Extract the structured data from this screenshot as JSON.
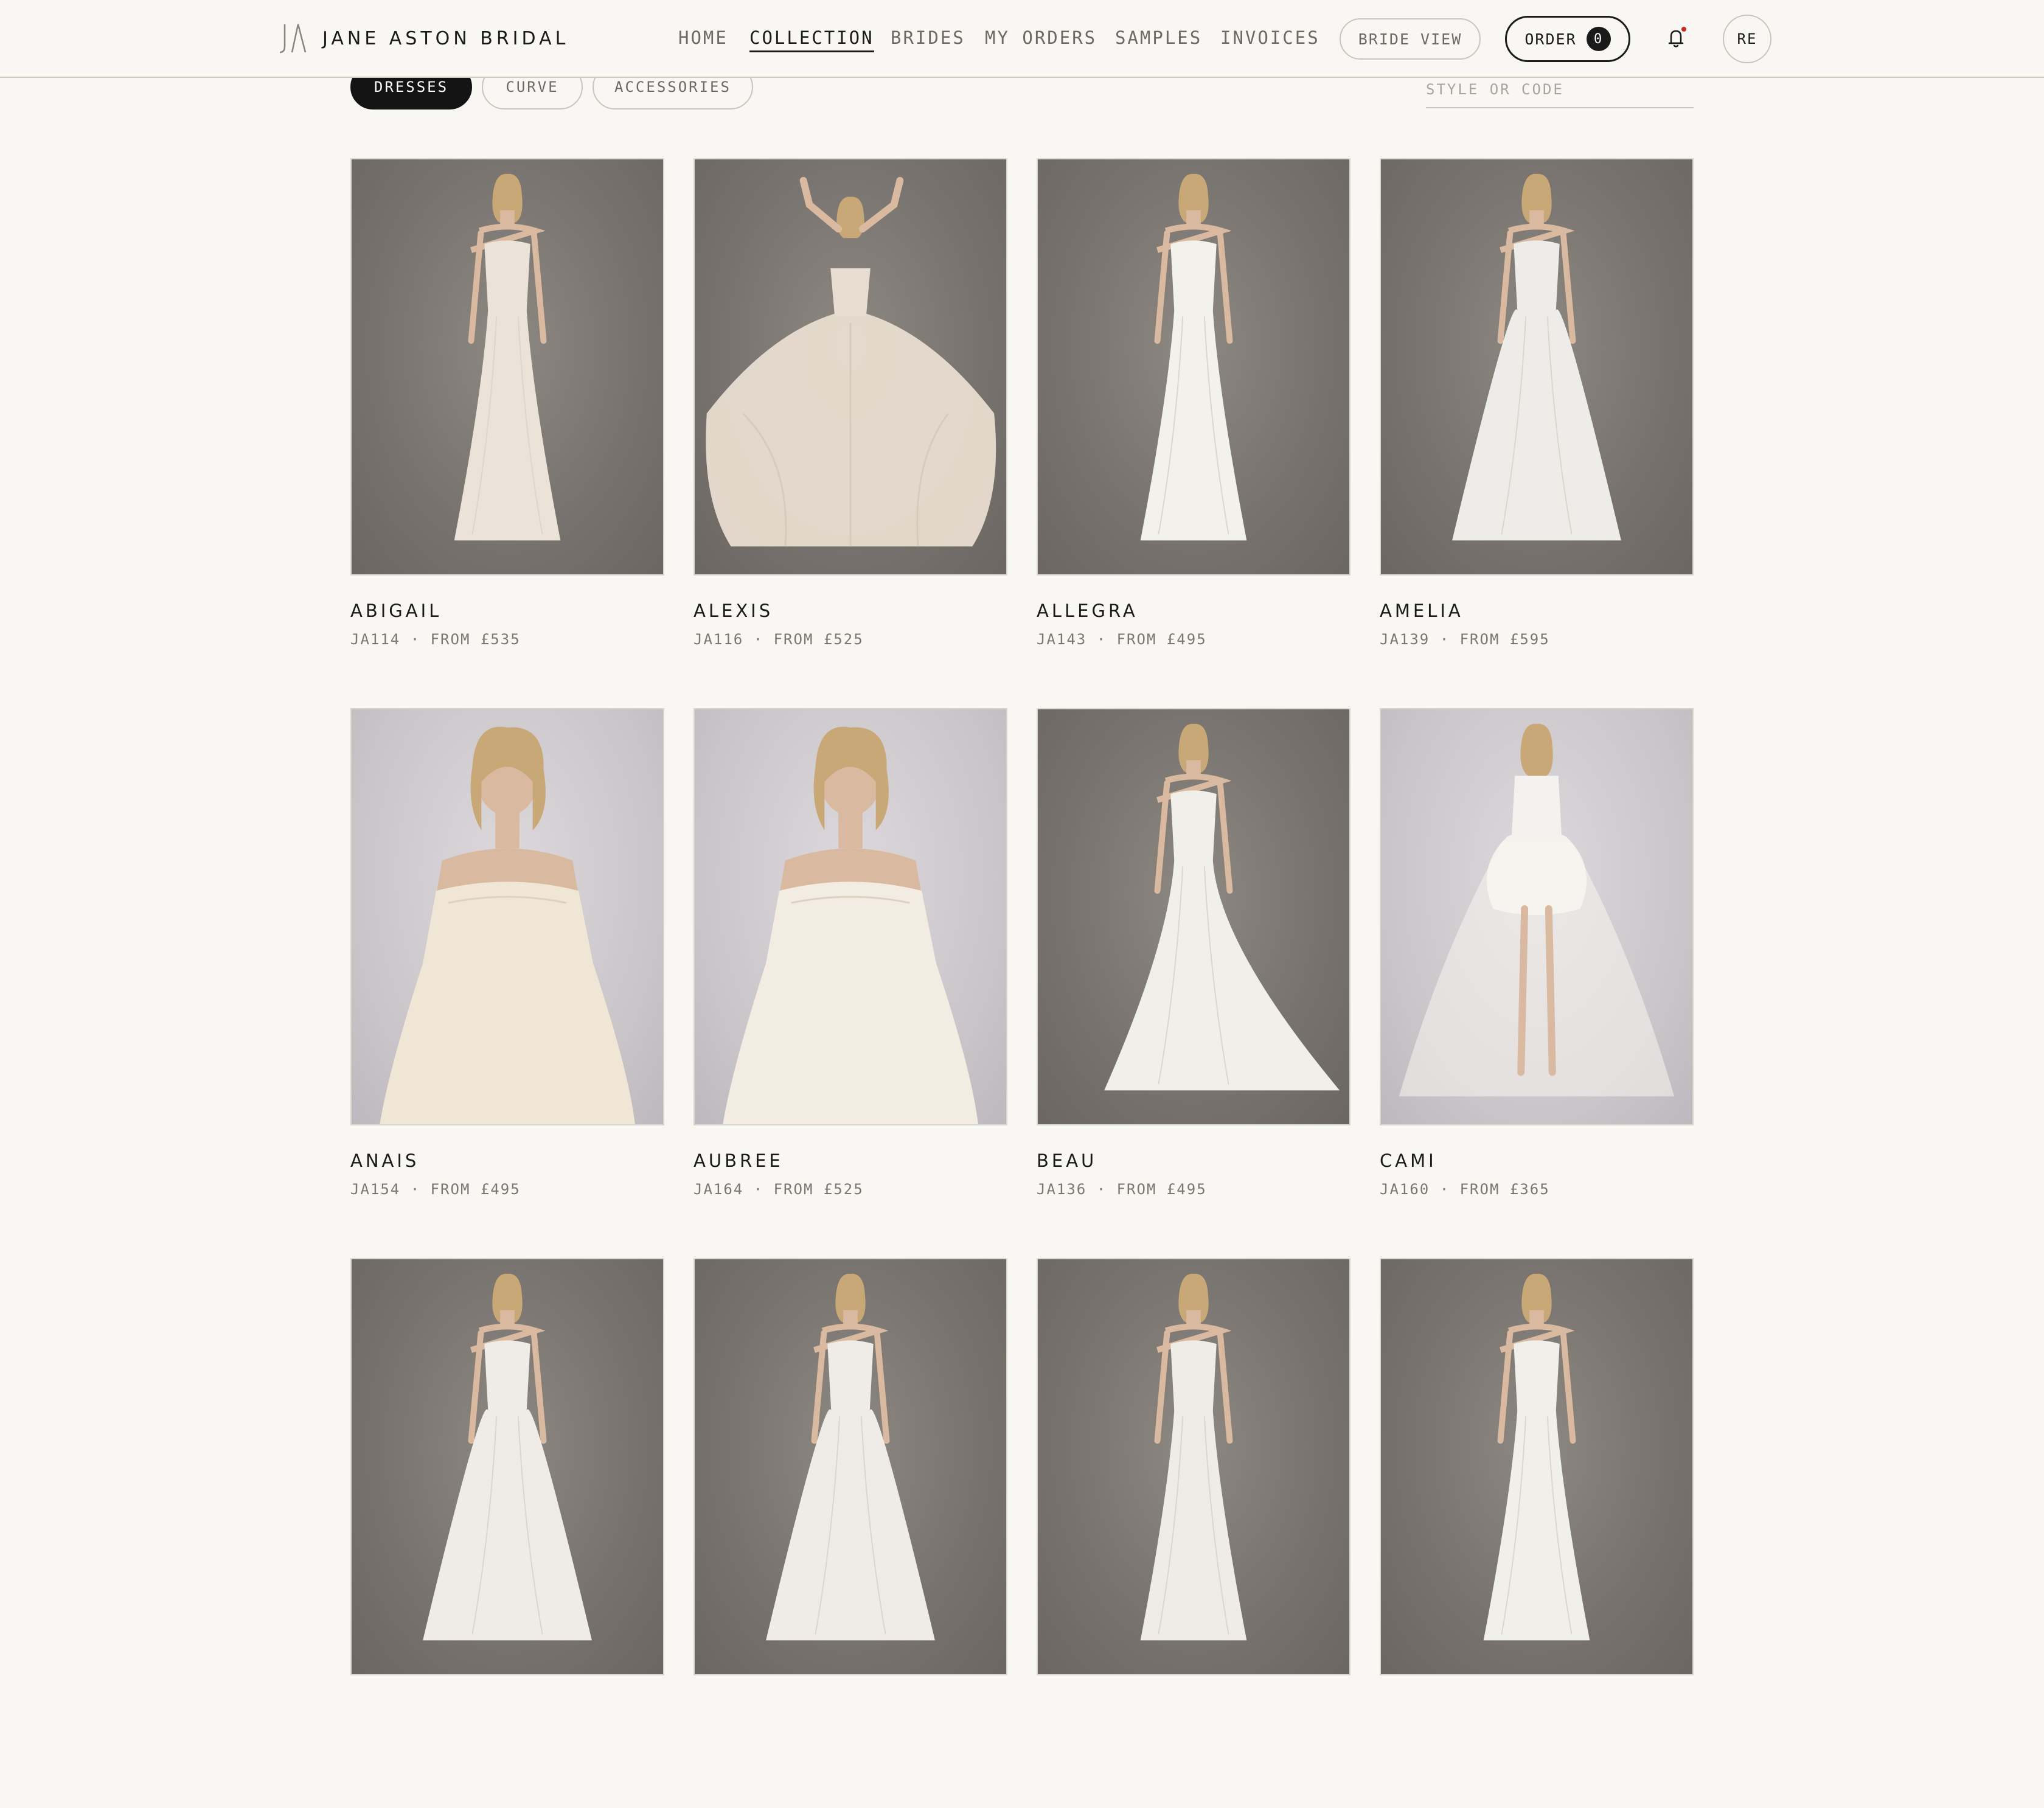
{
  "brand": {
    "name": "JANE ASTON BRIDAL",
    "logo_glyph": "JA"
  },
  "nav": [
    {
      "label": "HOME",
      "active": false
    },
    {
      "label": "COLLECTION",
      "active": true
    },
    {
      "label": "BRIDES",
      "active": false
    },
    {
      "label": "MY ORDERS",
      "active": false
    },
    {
      "label": "SAMPLES",
      "active": false
    },
    {
      "label": "INVOICES",
      "active": false
    }
  ],
  "header_actions": {
    "bride_view_label": "BRIDE VIEW",
    "order_label": "ORDER",
    "order_count": "0",
    "avatar_initials": "RE",
    "notification_dot_color": "#c62a2a"
  },
  "filters": {
    "tabs": [
      {
        "label": "DRESSES",
        "active": true
      },
      {
        "label": "CURVE",
        "active": false
      },
      {
        "label": "ACCESSORIES",
        "active": false
      }
    ],
    "search_placeholder": "STYLE OR CODE"
  },
  "colors": {
    "accent": "#141414",
    "background": "#f8f7f3",
    "muted_text": "#7a776f"
  },
  "products": [
    {
      "name": "ABIGAIL",
      "meta": "JA114 · FROM £535",
      "backdrop": "dark",
      "gown": "mermaid",
      "tone": "#ece3d8"
    },
    {
      "name": "ALEXIS",
      "meta": "JA116 · FROM £525",
      "backdrop": "dark",
      "gown": "ballgown",
      "tone": "#e8ddd0"
    },
    {
      "name": "ALLEGRA",
      "meta": "JA143 · FROM £495",
      "backdrop": "dark",
      "gown": "fit",
      "tone": "#f3f1ec"
    },
    {
      "name": "AMELIA",
      "meta": "JA139 · FROM £595",
      "backdrop": "dark",
      "gown": "aline",
      "tone": "#eeece8"
    },
    {
      "name": "ANAIS",
      "meta": "JA154 · FROM £495",
      "backdrop": "light",
      "gown": "closeup",
      "tone": "#efe6d6"
    },
    {
      "name": "AUBREE",
      "meta": "JA164 · FROM £525",
      "backdrop": "light",
      "gown": "closeup",
      "tone": "#f2ece3"
    },
    {
      "name": "BEAU",
      "meta": "JA136 · FROM £495",
      "backdrop": "dark",
      "gown": "train",
      "tone": "#f1efea"
    },
    {
      "name": "CAMI",
      "meta": "JA160 · FROM £365",
      "backdrop": "light",
      "gown": "short",
      "tone": "#f4f2ee"
    },
    {
      "name": "",
      "meta": "",
      "backdrop": "dark",
      "gown": "aline",
      "tone": "#efece7"
    },
    {
      "name": "",
      "meta": "",
      "backdrop": "dark",
      "gown": "aline",
      "tone": "#efece7"
    },
    {
      "name": "",
      "meta": "",
      "backdrop": "dark",
      "gown": "fit",
      "tone": "#efece7"
    },
    {
      "name": "",
      "meta": "",
      "backdrop": "dark",
      "gown": "mermaid",
      "tone": "#f1efea"
    }
  ]
}
